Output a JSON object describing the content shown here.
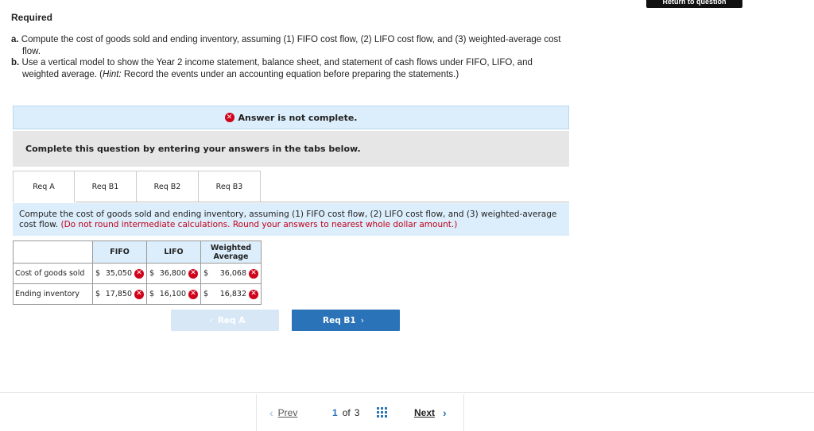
{
  "header": {
    "return_label": "Return to question"
  },
  "required": {
    "title": "Required",
    "a_label": "a.",
    "a_text": "Compute the cost of goods sold and ending inventory, assuming (1) FIFO cost flow, (2) LIFO cost flow, and (3) weighted-average cost",
    "a_text2": "flow.",
    "b_label": "b.",
    "b_text": "Use a vertical model to show the Year 2 income statement, balance sheet, and statement of cash flows under FIFO, LIFO, and",
    "b_text2_pre": "weighted average. (",
    "b_hint": "Hint:",
    "b_text2_post": " Record the events under an accounting equation before preparing the statements.)"
  },
  "banner": {
    "status": "Answer is not complete."
  },
  "instructions": "Complete this question by entering your answers in the tabs below.",
  "tabs": [
    "Req A",
    "Req B1",
    "Req B2",
    "Req B3"
  ],
  "question": {
    "text": "Compute the cost of goods sold and ending inventory, assuming (1) FIFO cost flow, (2) LIFO cost flow, and (3) weighted-average cost flow.",
    "note": "(Do not round intermediate calculations. Round your answers to nearest whole dollar amount.)"
  },
  "table": {
    "headers": [
      "FIFO",
      "LIFO",
      "Weighted Average"
    ],
    "rows": [
      {
        "label": "Cost of goods sold",
        "fifo": "35,050",
        "lifo": "36,800",
        "wa": "36,068"
      },
      {
        "label": "Ending inventory",
        "fifo": "17,850",
        "lifo": "16,100",
        "wa": "16,832"
      }
    ],
    "currency": "$"
  },
  "nav": {
    "prev_label": "Req A",
    "next_label": "Req B1"
  },
  "pager": {
    "prev": "Prev",
    "current": "1",
    "of": "of",
    "total": "3",
    "next": "Next"
  },
  "colors": {
    "accent": "#2a73b8",
    "error": "#d0021b",
    "banner_bg": "#dceefb"
  }
}
